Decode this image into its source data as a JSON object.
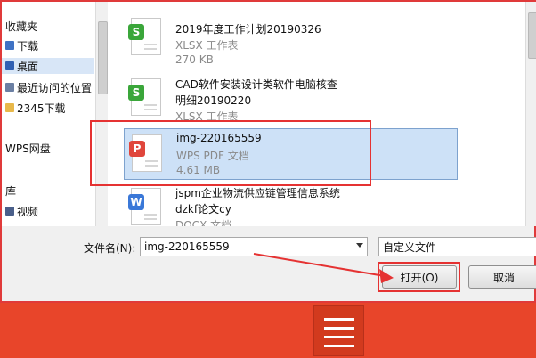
{
  "sidebar": {
    "items": [
      {
        "label": "收藏夹",
        "icon": "star-icon"
      },
      {
        "label": "下载",
        "icon": "download-folder-icon"
      },
      {
        "label": "桌面",
        "icon": "desktop-icon"
      },
      {
        "label": "最近访问的位置",
        "icon": "recent-places-icon"
      },
      {
        "label": "2345下载",
        "icon": "folder-icon"
      },
      {
        "label": "WPS网盘",
        "icon": "cloud-drive-icon"
      },
      {
        "label": "库",
        "icon": "library-icon"
      },
      {
        "label": "视频",
        "icon": "video-folder-icon"
      }
    ]
  },
  "files": [
    {
      "name": "2019年度工作计划20190326",
      "name2": "",
      "type": "XLSX 工作表",
      "size": "270 KB",
      "icon": "xlsx-file-icon",
      "badge": "S",
      "color": "#3aa63a"
    },
    {
      "name": "CAD软件安装设计类软件电脑核查",
      "name2": "明细20190220",
      "type": "XLSX 工作表",
      "size": "",
      "icon": "xlsx-file-icon",
      "badge": "S",
      "color": "#3aa63a"
    },
    {
      "name": "img-220165559",
      "name2": "",
      "type": "WPS PDF 文档",
      "size": "4.61 MB",
      "icon": "pdf-file-icon",
      "badge": "P",
      "color": "#e0463c"
    },
    {
      "name": "jspm企业物流供应链管理信息系统",
      "name2": "dzkf论文cy",
      "type": "DOCX 文档",
      "size": "",
      "icon": "docx-file-icon",
      "badge": "W",
      "color": "#3a78d8"
    }
  ],
  "filename": {
    "label": "文件名(N):",
    "value": "img-220165559"
  },
  "filetype": {
    "value": "自定义文件"
  },
  "buttons": {
    "open": "打开(O)",
    "cancel": "取消"
  },
  "colors": {
    "highlight": "#e53232",
    "background": "#e8452a"
  }
}
